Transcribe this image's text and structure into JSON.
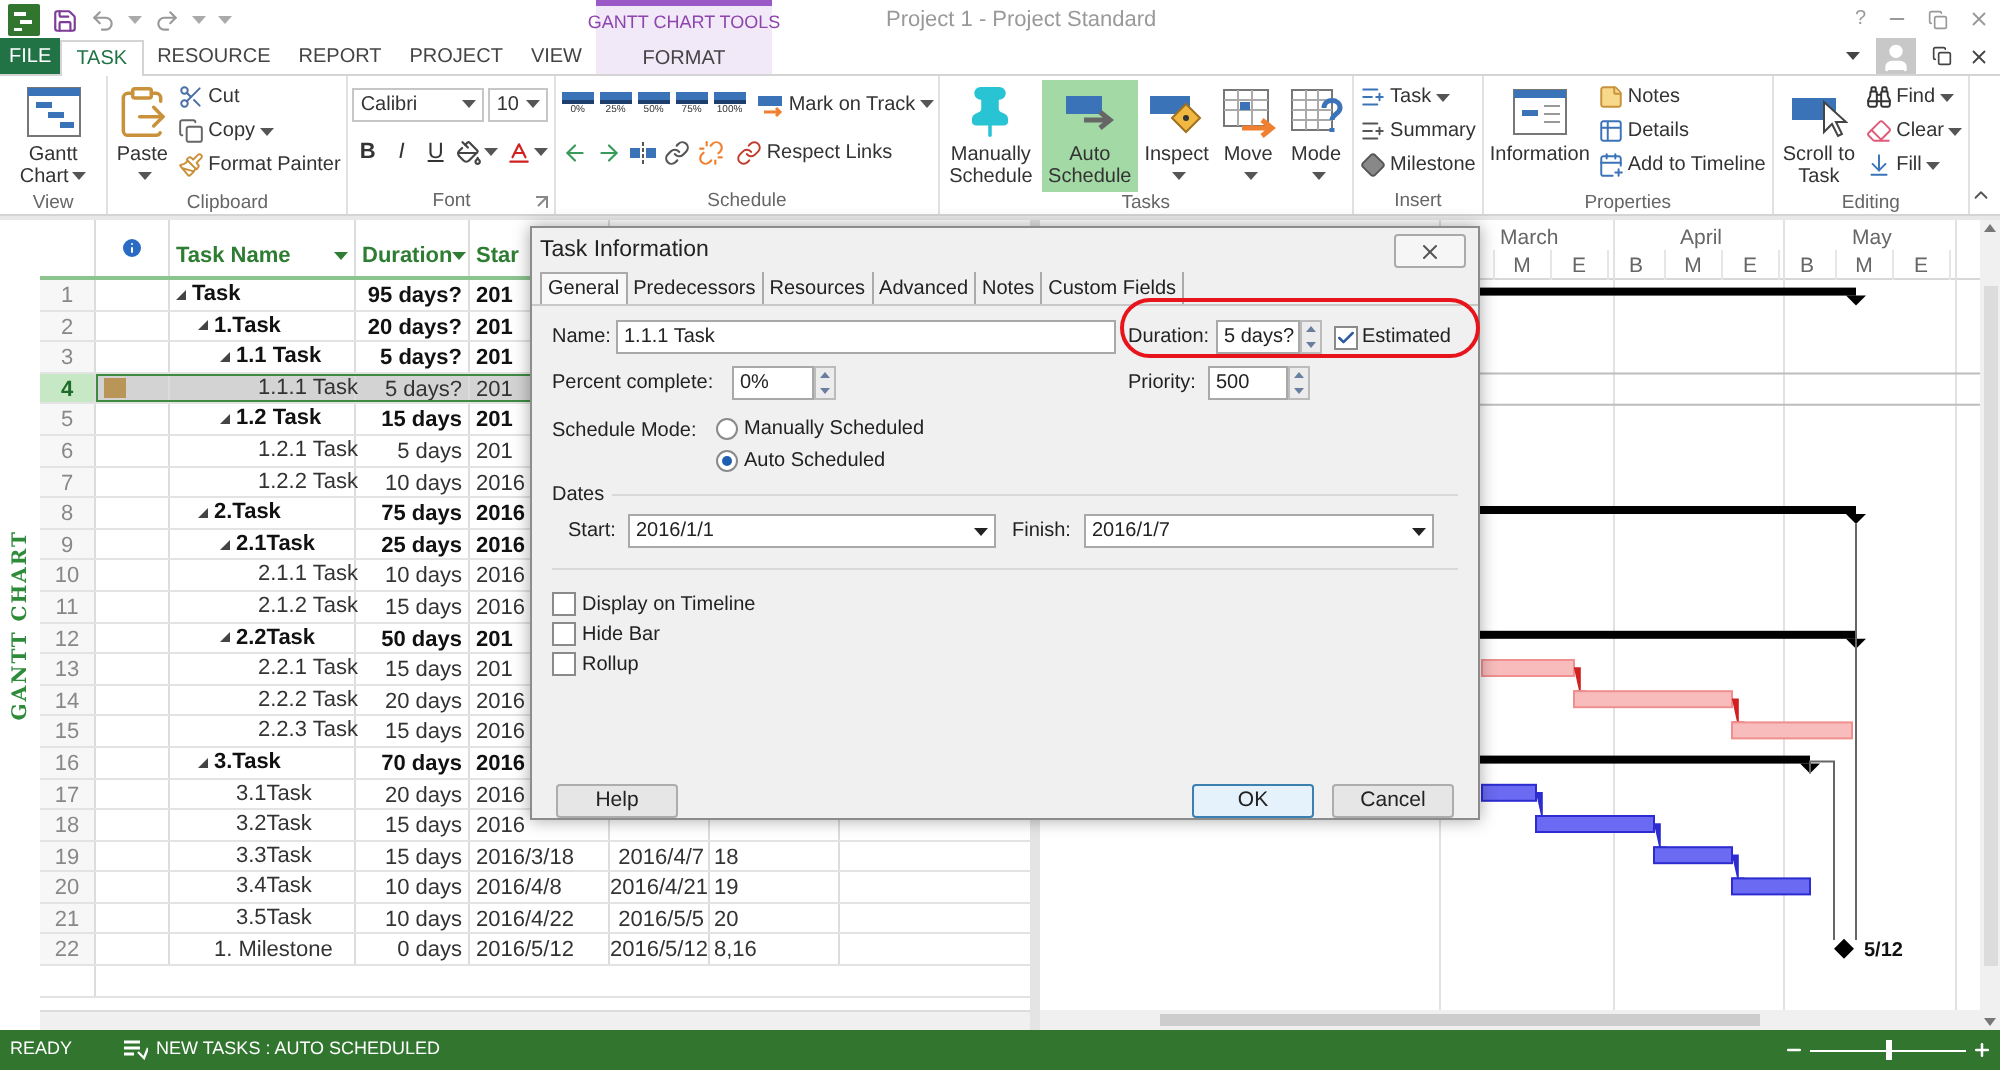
{
  "title_bar": {
    "contextual_header": "GANTT CHART TOOLS",
    "title": "Project 1 - Project Standard",
    "help": "?"
  },
  "tabs": [
    {
      "label": "FILE",
      "kind": "file",
      "selected": false
    },
    {
      "label": "TASK",
      "kind": "tab",
      "selected": true
    },
    {
      "label": "RESOURCE",
      "kind": "tab",
      "selected": false
    },
    {
      "label": "REPORT",
      "kind": "tab",
      "selected": false
    },
    {
      "label": "PROJECT",
      "kind": "tab",
      "selected": false
    },
    {
      "label": "VIEW",
      "kind": "tab",
      "selected": false
    },
    {
      "label": "FORMAT",
      "kind": "contextual",
      "selected": false
    }
  ],
  "ribbon_groups": [
    {
      "label": "View",
      "launcher": false,
      "columns": [
        [
          {
            "kind": "large",
            "label": "Gantt Chart",
            "dropdown": true,
            "selected": false
          }
        ]
      ]
    },
    {
      "label": "Clipboard",
      "launcher": false,
      "columns": [
        [
          {
            "kind": "large",
            "label": "Paste",
            "dropdown": true,
            "selected": false
          }
        ],
        [
          {
            "kind": "small",
            "label": "Cut",
            "dropdown": false
          },
          {
            "kind": "small",
            "label": "Copy",
            "dropdown": true
          },
          {
            "kind": "small",
            "label": "Format Painter",
            "dropdown": false
          }
        ]
      ]
    },
    {
      "label": "Font",
      "launcher": true,
      "columns": [
        [
          {
            "kind": "toolbar",
            "buttons": [
              {
                "kind": "combo",
                "value": "Calibri"
              },
              {
                "kind": "combo",
                "value": "10"
              }
            ]
          },
          {
            "kind": "toolbar",
            "buttons": [
              {
                "kind": "glyph",
                "label": "B"
              },
              {
                "kind": "glyph",
                "label": "I"
              },
              {
                "kind": "glyph",
                "label": "U"
              },
              {
                "kind": "icon",
                "dropdown": true
              },
              {
                "kind": "icon",
                "dropdown": true
              }
            ]
          }
        ]
      ]
    },
    {
      "label": "Schedule",
      "launcher": false,
      "columns": [
        [
          {
            "kind": "toolbar",
            "buttons": [
              {
                "kind": "percent",
                "label": "0%"
              },
              {
                "kind": "percent",
                "label": "25%"
              },
              {
                "kind": "percent",
                "label": "50%"
              },
              {
                "kind": "percent",
                "label": "75%"
              },
              {
                "kind": "percent",
                "label": "100%"
              },
              {
                "kind": "small",
                "label": "Mark on Track",
                "dropdown": true
              }
            ]
          },
          {
            "kind": "toolbar",
            "buttons": [
              {
                "kind": "icon",
                "dropdown": false
              },
              {
                "kind": "icon",
                "dropdown": false
              },
              {
                "kind": "icon",
                "dropdown": false
              },
              {
                "kind": "icon",
                "dropdown": false
              },
              {
                "kind": "icon",
                "dropdown": false
              },
              {
                "kind": "small",
                "label": "Respect Links",
                "dropdown": false
              }
            ]
          }
        ]
      ]
    },
    {
      "label": "Tasks",
      "launcher": false,
      "columns": [
        [
          {
            "kind": "large",
            "label": "Manually Schedule",
            "dropdown": false,
            "selected": false
          }
        ],
        [
          {
            "kind": "large",
            "label": "Auto Schedule",
            "dropdown": false,
            "selected": true
          }
        ],
        [
          {
            "kind": "large",
            "label": "Inspect",
            "dropdown": true,
            "selected": false
          }
        ],
        [
          {
            "kind": "large",
            "label": "Move",
            "dropdown": true,
            "selected": false
          }
        ],
        [
          {
            "kind": "large",
            "label": "Mode",
            "dropdown": true,
            "selected": false
          }
        ]
      ]
    },
    {
      "label": "Insert",
      "launcher": false,
      "columns": [
        [
          {
            "kind": "small",
            "label": "Task",
            "dropdown": true
          },
          {
            "kind": "small",
            "label": "Summary",
            "dropdown": false
          },
          {
            "kind": "small",
            "label": "Milestone",
            "dropdown": false
          }
        ]
      ]
    },
    {
      "label": "Properties",
      "launcher": false,
      "columns": [
        [
          {
            "kind": "large",
            "label": "Information",
            "dropdown": false,
            "selected": false
          }
        ],
        [
          {
            "kind": "small",
            "label": "Notes",
            "dropdown": false
          },
          {
            "kind": "small",
            "label": "Details",
            "dropdown": false
          },
          {
            "kind": "small",
            "label": "Add to Timeline",
            "dropdown": false
          }
        ]
      ]
    },
    {
      "label": "Editing",
      "launcher": false,
      "columns": [
        [
          {
            "kind": "large",
            "label": "Scroll to Task",
            "dropdown": false,
            "selected": false
          }
        ],
        [
          {
            "kind": "small",
            "label": "Find",
            "dropdown": true
          },
          {
            "kind": "small",
            "label": "Clear",
            "dropdown": true
          },
          {
            "kind": "small",
            "label": "Fill",
            "dropdown": true
          }
        ]
      ]
    }
  ],
  "view_label": "GANTT CHART",
  "table": {
    "columns": [
      {
        "kind": "info"
      },
      {
        "kind": "text",
        "label": "Task Name",
        "dropdown": true
      },
      {
        "kind": "text",
        "label": "Duration",
        "dropdown": true
      },
      {
        "kind": "text",
        "label": "Star"
      }
    ],
    "rows": [
      {
        "id": "1",
        "name": "Task",
        "duration": "95 days?",
        "start": "201",
        "selected": false,
        "note": false,
        "expanded": true,
        "children": [
          {
            "id": "2",
            "name": "1.Task",
            "duration": "20 days?",
            "start": "201",
            "selected": false,
            "note": false,
            "expanded": true,
            "children": [
              {
                "id": "3",
                "name": "1.1 Task",
                "duration": "5 days?",
                "start": "201",
                "selected": false,
                "note": false,
                "expanded": true,
                "children": [
                  {
                    "id": "4",
                    "name": "1.1.1 Task",
                    "duration": "5 days?",
                    "start": "201",
                    "selected": true,
                    "note": true
                  }
                ]
              },
              {
                "id": "5",
                "name": "1.2 Task",
                "duration": "15 days",
                "start": "201",
                "selected": false,
                "note": false,
                "expanded": true,
                "children": [
                  {
                    "id": "6",
                    "name": "1.2.1 Task",
                    "duration": "5 days",
                    "start": "201",
                    "selected": false,
                    "note": false
                  },
                  {
                    "id": "7",
                    "name": "1.2.2 Task",
                    "duration": "10 days",
                    "start": "2016",
                    "selected": false,
                    "note": false
                  }
                ]
              }
            ]
          },
          {
            "id": "8",
            "name": "2.Task",
            "duration": "75 days",
            "start": "2016",
            "selected": false,
            "note": false,
            "expanded": true,
            "children": [
              {
                "id": "9",
                "name": "2.1Task",
                "duration": "25 days",
                "start": "2016",
                "selected": false,
                "note": false,
                "expanded": true,
                "children": [
                  {
                    "id": "10",
                    "name": "2.1.1 Task",
                    "duration": "10 days",
                    "start": "2016",
                    "selected": false,
                    "note": false
                  },
                  {
                    "id": "11",
                    "name": "2.1.2 Task",
                    "duration": "15 days",
                    "start": "2016",
                    "selected": false,
                    "note": false
                  }
                ]
              },
              {
                "id": "12",
                "name": "2.2Task",
                "duration": "50 days",
                "start": "201",
                "selected": false,
                "note": false,
                "expanded": true,
                "children": [
                  {
                    "id": "13",
                    "name": "2.2.1 Task",
                    "duration": "15 days",
                    "start": "201",
                    "selected": false,
                    "note": false
                  },
                  {
                    "id": "14",
                    "name": "2.2.2 Task",
                    "duration": "20 days",
                    "start": "2016",
                    "selected": false,
                    "note": false
                  },
                  {
                    "id": "15",
                    "name": "2.2.3 Task",
                    "duration": "15 days",
                    "start": "2016",
                    "selected": false,
                    "note": false
                  }
                ]
              }
            ]
          },
          {
            "id": "16",
            "name": "3.Task",
            "duration": "70 days",
            "start": "2016",
            "selected": false,
            "note": false,
            "expanded": true,
            "children": [
              {
                "id": "17",
                "name": "3.1Task",
                "duration": "20 days",
                "start": "2016",
                "selected": false,
                "note": false
              },
              {
                "id": "18",
                "name": "3.2Task",
                "duration": "15 days",
                "start": "2016",
                "selected": false,
                "note": false
              },
              {
                "id": "19",
                "name": "3.3Task",
                "duration": "15 days",
                "start": "2016/3/18",
                "finish": "2016/4/7",
                "predecessors": "18",
                "selected": false,
                "note": false
              },
              {
                "id": "20",
                "name": "3.4Task",
                "duration": "10 days",
                "start": "2016/4/8",
                "finish": "2016/4/21",
                "predecessors": "19",
                "selected": false,
                "note": false
              },
              {
                "id": "21",
                "name": "3.5Task",
                "duration": "10 days",
                "start": "2016/4/22",
                "finish": "2016/5/5",
                "predecessors": "20",
                "selected": false,
                "note": false
              }
            ]
          },
          {
            "id": "22",
            "name": "1. Milestone",
            "duration": "0 days",
            "start": "2016/5/12",
            "finish": "2016/5/12",
            "predecessors": "8,16",
            "selected": false,
            "note": false
          }
        ]
      }
    ]
  },
  "timescale": {
    "months": [
      {
        "label": "March"
      },
      {
        "label": "April"
      },
      {
        "label": "May"
      }
    ],
    "days": [
      {
        "label": "M"
      },
      {
        "label": "E"
      },
      {
        "label": "B"
      },
      {
        "label": "M"
      },
      {
        "label": "E"
      },
      {
        "label": "B"
      },
      {
        "label": "M"
      },
      {
        "label": "E"
      }
    ]
  },
  "milestone_label": "5/12",
  "dialog": {
    "title": "Task Information",
    "tabs": [
      {
        "label": "General",
        "selected": true
      },
      {
        "label": "Predecessors",
        "selected": false
      },
      {
        "label": "Resources",
        "selected": false
      },
      {
        "label": "Advanced",
        "selected": false
      },
      {
        "label": "Notes",
        "selected": false
      },
      {
        "label": "Custom Fields",
        "selected": false
      }
    ],
    "name": {
      "label": "Name:",
      "value": "1.1.1 Task"
    },
    "duration": {
      "label": "Duration:",
      "value": "5 days?"
    },
    "estimated": {
      "label": "Estimated",
      "checked": true
    },
    "percent_complete": {
      "label": "Percent complete:",
      "value": "0%"
    },
    "priority": {
      "label": "Priority:",
      "value": "500"
    },
    "schedule_mode": {
      "label": "Schedule Mode:",
      "options": [
        {
          "label": "Manually Scheduled",
          "selected": false
        },
        {
          "label": "Auto Scheduled",
          "selected": true
        }
      ]
    },
    "dates": {
      "label": "Dates",
      "start": {
        "label": "Start:",
        "value": "2016/1/1"
      },
      "finish": {
        "label": "Finish:",
        "value": "2016/1/7"
      }
    },
    "options": [
      {
        "label": "Display on Timeline",
        "checked": false
      },
      {
        "label": "Hide Bar",
        "checked": false
      },
      {
        "label": "Rollup",
        "checked": false
      }
    ],
    "buttons": [
      {
        "label": "Help",
        "kind": "normal"
      },
      {
        "label": "OK",
        "kind": "default"
      },
      {
        "label": "Cancel",
        "kind": "normal"
      }
    ]
  },
  "status_bar": {
    "mode": "READY",
    "new_tasks": "NEW TASKS : AUTO SCHEDULED",
    "zoom": {
      "level": 0.5
    }
  }
}
